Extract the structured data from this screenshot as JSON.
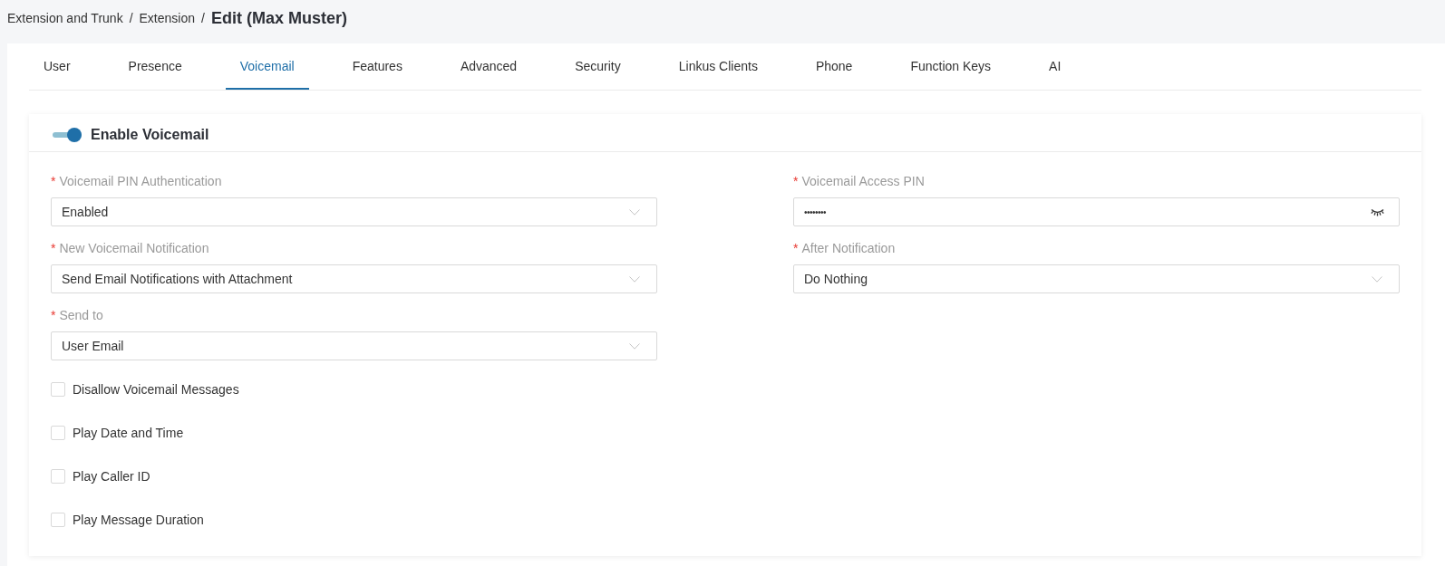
{
  "breadcrumb": {
    "items": [
      {
        "label": "Extension and Trunk",
        "separator": "/"
      },
      {
        "label": "Extension",
        "separator": "/"
      }
    ],
    "current": "Edit (Max Muster)"
  },
  "tabs": [
    {
      "label": "User",
      "selected": false
    },
    {
      "label": "Presence",
      "selected": false
    },
    {
      "label": "Voicemail",
      "selected": true
    },
    {
      "label": "Features",
      "selected": false
    },
    {
      "label": "Advanced",
      "selected": false
    },
    {
      "label": "Security",
      "selected": false
    },
    {
      "label": "Linkus Clients",
      "selected": false
    },
    {
      "label": "Phone",
      "selected": false
    },
    {
      "label": "Function Keys",
      "selected": false
    },
    {
      "label": "AI",
      "selected": false
    }
  ],
  "section": {
    "title": "Enable Voicemail",
    "on": true
  },
  "fields": [
    {
      "label": "Voicemail PIN Authentication",
      "required_mark": "*",
      "kind": "select",
      "value": "Enabled"
    },
    {
      "label": "Voicemail Access PIN",
      "required_mark": "*",
      "kind": "password",
      "value": "••••••••"
    },
    {
      "label": "New Voicemail Notification",
      "required_mark": "*",
      "kind": "select",
      "value": "Send Email Notifications with Attachment"
    },
    {
      "label": "After Notification",
      "required_mark": "*",
      "kind": "select",
      "value": "Do Nothing"
    },
    {
      "label": "Send to",
      "required_mark": "*",
      "kind": "select",
      "value": "User Email"
    }
  ],
  "checkboxes": [
    {
      "label": "Disallow Voicemail Messages",
      "checked": false
    },
    {
      "label": "Play Date and Time",
      "checked": false
    },
    {
      "label": "Play Caller ID",
      "checked": false
    },
    {
      "label": "Play Message Duration",
      "checked": false
    }
  ]
}
